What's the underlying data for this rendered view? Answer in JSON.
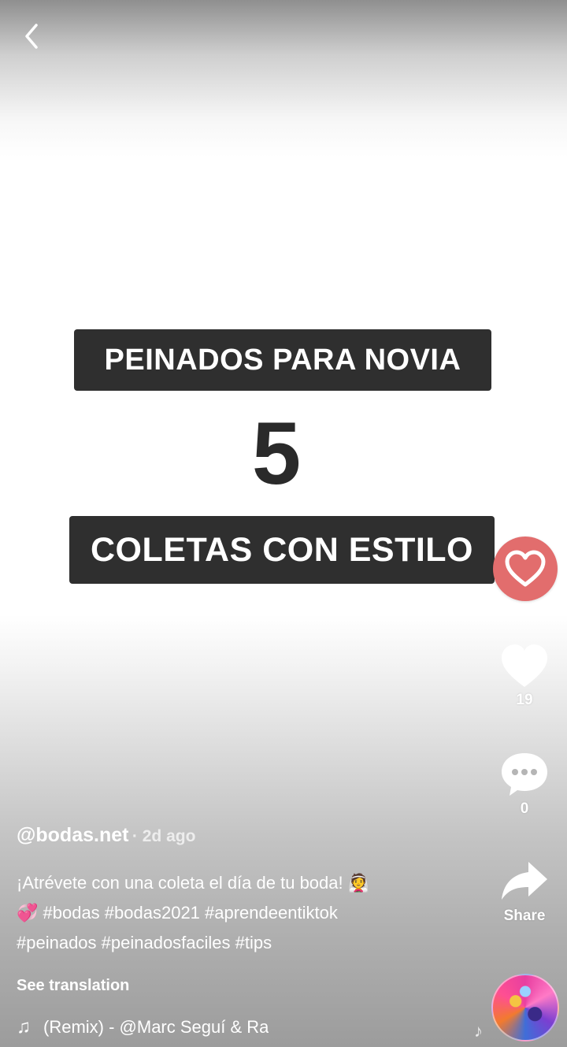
{
  "video": {
    "banner_top": "PEINADOS PARA NOVIA",
    "number": "5",
    "banner_bottom": "COLETAS CON ESTILO"
  },
  "actions": {
    "like_count": "19",
    "comment_count": "0",
    "share_label": "Share"
  },
  "post": {
    "username": "@bodas.net",
    "time_ago": "· 2d ago",
    "caption_line1": "¡Atrévete con una coleta el día de tu boda! 👰",
    "caption_line2": "💞 #bodas #bodas2021 #aprendeentiktok",
    "caption_line3": "#peinados #peinadosfaciles #tips",
    "see_translation": "See translation",
    "music": "(Remix) - @Marc Seguí & Ra",
    "music_note_icon": "♫"
  },
  "icons": [
    "back-chevron-icon",
    "heart-icon",
    "like-heart-icon",
    "comment-bubble-icon",
    "share-arrow-icon",
    "music-note-icon",
    "music-disc-icon"
  ],
  "colors": {
    "banner_bg": "#2f2f2f",
    "heart_badge": "#e26d6d",
    "text_light": "#ffffff"
  }
}
